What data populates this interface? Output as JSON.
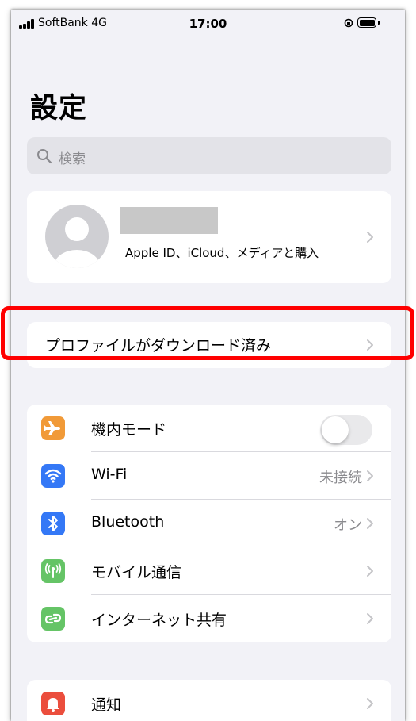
{
  "status_bar": {
    "carrier": "SoftBank  4G",
    "time": "17:00"
  },
  "title": "設定",
  "search": {
    "placeholder": "検索"
  },
  "profile": {
    "subtitle": "Apple ID、iCloud、メディアと購入"
  },
  "download_banner": {
    "label": "プロファイルがダウンロード済み"
  },
  "settings_rows": [
    {
      "label": "機内モード",
      "icon": "airplane-icon",
      "color": "#f19a38",
      "toggle_on": false
    },
    {
      "label": "Wi-Fi",
      "icon": "wifi-icon",
      "color": "#3478f6",
      "value": "未接続"
    },
    {
      "label": "Bluetooth",
      "icon": "bluetooth-icon",
      "color": "#3478f6",
      "value": "オン"
    },
    {
      "label": "モバイル通信",
      "icon": "antenna-icon",
      "color": "#65c466"
    },
    {
      "label": "インターネット共有",
      "icon": "hotspot-icon",
      "color": "#65c466"
    }
  ],
  "notifications_row": {
    "label": "通知",
    "icon": "bell-icon",
    "color": "#eb4e3d"
  },
  "colors": {
    "background": "#f2f2f7",
    "highlight": "#ff0000",
    "chevron": "#c4c4c7"
  }
}
